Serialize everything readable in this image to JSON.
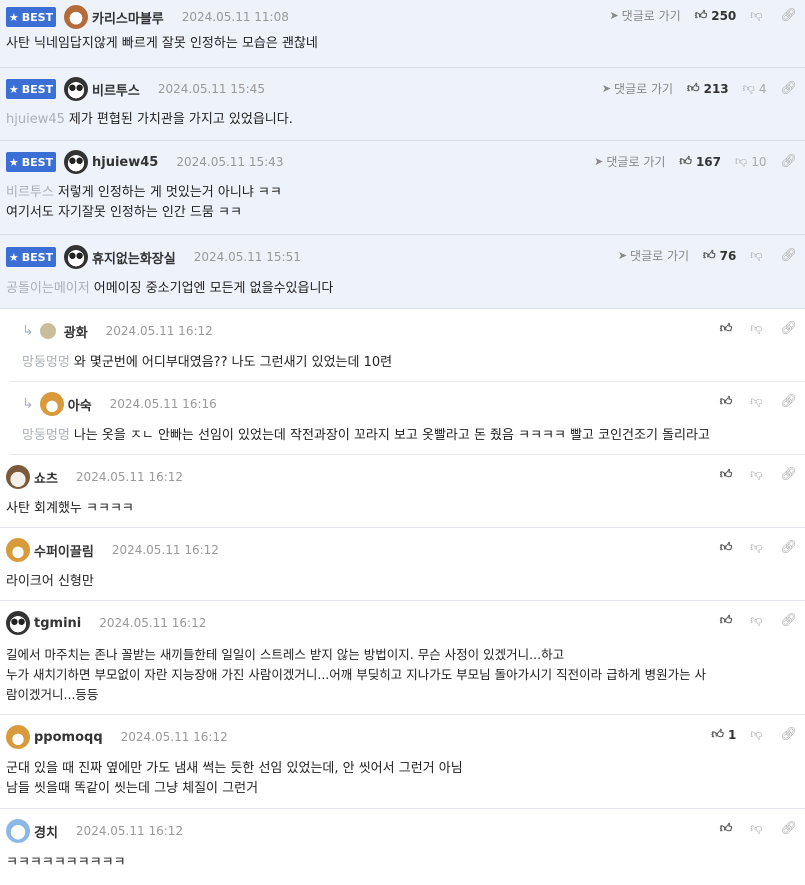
{
  "best_label": "BEST",
  "reply_link_label": "댓글로 가기",
  "comments": [
    {
      "nick": "카리스마블루",
      "date": "2024.05.11 11:08",
      "likes": "250",
      "dislikes": "",
      "mention": "",
      "lines": [
        "사탄 닉네임답지않게 빠르게 잘못 인정하는 모습은 괜찮네"
      ]
    },
    {
      "nick": "비르투스",
      "date": "2024.05.11 15:45",
      "likes": "213",
      "dislikes": "4",
      "mention": "hjuiew45",
      "lines": [
        "제가 편협된 가치관을 가지고 있었읍니다."
      ]
    },
    {
      "nick": "hjuiew45",
      "date": "2024.05.11 15:43",
      "likes": "167",
      "dislikes": "10",
      "mention": "비르투스",
      "lines": [
        "저렇게 인정하는 게 멋있는거 아니냐 ㅋㅋ",
        "여기서도 자기잘못 인정하는 인간 드뭄 ㅋㅋ"
      ]
    },
    {
      "nick": "휴지없는화장실",
      "date": "2024.05.11 15:51",
      "likes": "76",
      "dislikes": "",
      "mention": "공돌이는메이저",
      "lines": [
        "어메이징 중소기업엔 모든게 없을수있읍니다"
      ]
    },
    {
      "nick": "광화",
      "date": "2024.05.11 16:12",
      "likes": "",
      "dislikes": "",
      "mention": "망둥멍멍",
      "lines": [
        "와 몇군번에 어디부대였음?? 나도 그런새기 있었는데 10련"
      ]
    },
    {
      "nick": "아숙",
      "date": "2024.05.11 16:16",
      "likes": "",
      "dislikes": "",
      "mention": "망둥멍멍",
      "lines": [
        "나는 옷을 ㅈㄴ 안빠는 선임이 있었는데 작전과장이 꼬라지 보고 옷빨라고 돈 줬음 ㅋㅋㅋㅋ 빨고 코인건조기 돌리라고"
      ]
    },
    {
      "nick": "쇼츠",
      "date": "2024.05.11 16:12",
      "likes": "",
      "dislikes": "",
      "mention": "",
      "lines": [
        "사탄 회계했누 ㅋㅋㅋㅋ"
      ]
    },
    {
      "nick": "수퍼이끌림",
      "date": "2024.05.11 16:12",
      "likes": "",
      "dislikes": "",
      "mention": "",
      "lines": [
        "라이크어 신형만"
      ]
    },
    {
      "nick": "tgmini",
      "date": "2024.05.11 16:12",
      "likes": "",
      "dislikes": "",
      "mention": "",
      "lines": [
        "길에서 마주치는 존나 꼴받는 새끼들한테 일일이 스트레스 받지 않는 방법이지. 무슨 사정이 있겠거니...하고",
        "누가 새치기하면 부모없이 자란 지능장애 가진 사람이겠거니...어깨 부딪히고 지나가도 부모님 돌아가시기 직전이라 급하게 병원가는 사",
        "람이겠거니...등등"
      ]
    },
    {
      "nick": "ppomoqq",
      "date": "2024.05.11 16:12",
      "likes": "1",
      "dislikes": "",
      "mention": "",
      "lines": [
        "군대 있을 때 진짜 옆에만 가도 냄새 썩는 듯한 선임 있었는데, 안 씻어서 그런거 아님",
        "남들 씻을때 똑같이 씻는데 그냥 체질이 그런거"
      ]
    },
    {
      "nick": "경치",
      "date": "2024.05.11 16:12",
      "likes": "",
      "dislikes": "",
      "mention": "",
      "lines": [
        "ㅋㅋㅋㅋㅋㅋㅋㅋㅋㅋ"
      ]
    }
  ],
  "icons": {
    "like": "thumb-up-icon",
    "dislike": "thumb-down-icon",
    "link": "link-icon",
    "reply_link": "paper-plane-icon",
    "reply_arrow": "reply-arrow-icon",
    "best_star": "star-icon"
  },
  "colors": {
    "best_bg": "#eef2fb",
    "badge": "#3b6fd6"
  }
}
